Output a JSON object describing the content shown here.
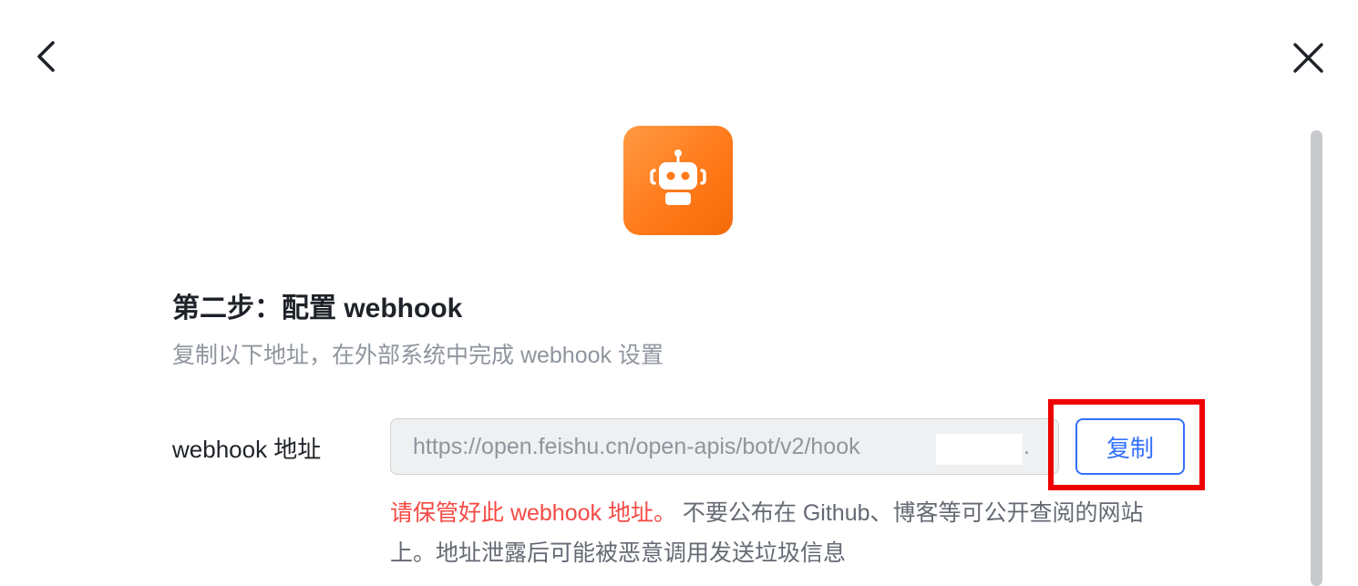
{
  "header": {
    "back_icon": "chevron-left-icon",
    "close_icon": "close-icon"
  },
  "bot": {
    "icon": "robot-icon",
    "colors": {
      "gradient_start": "#ff9a44",
      "gradient_end": "#f56a0a"
    }
  },
  "step": {
    "title": "第二步：配置 webhook",
    "description": "复制以下地址，在外部系统中完成 webhook 设置"
  },
  "webhook": {
    "label": "webhook 地址",
    "url_visible": "https://open.feishu.cn/open-apis/bot/v2/hook",
    "url_trailing": ".",
    "copy_label": "复制"
  },
  "warning": {
    "emphasis": "请保管好此 webhook 地址。",
    "text": " 不要公布在 Github、博客等可公开查阅的网站上。地址泄露后可能被恶意调用发送垃圾信息"
  },
  "colors": {
    "accent": "#3370ff",
    "warning_red": "#f54a45",
    "highlight_frame": "#ee0000"
  }
}
